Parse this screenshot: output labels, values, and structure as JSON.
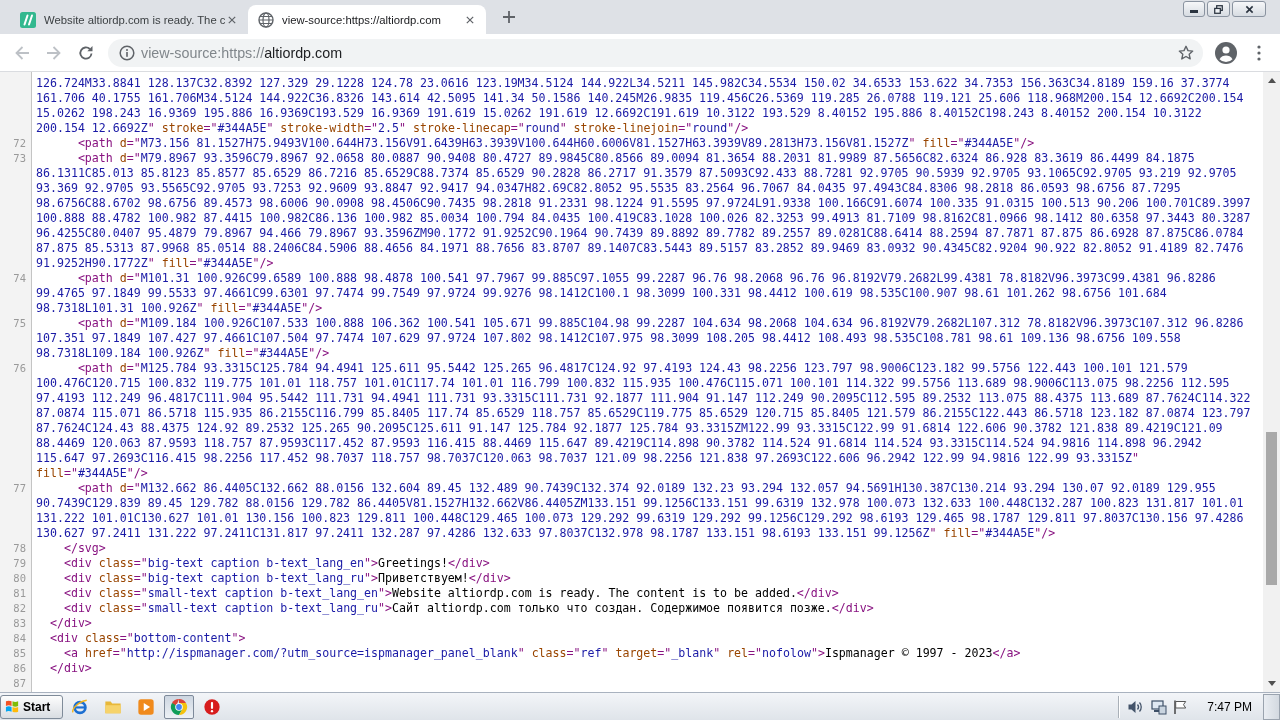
{
  "browser": {
    "tabs": [
      {
        "kind": "site",
        "title": "Website altiordp.com is ready. The c",
        "selected": false
      },
      {
        "kind": "source",
        "title": "view-source:https://altiordp.com",
        "selected": true
      }
    ],
    "nav": [
      {
        "kind": "back",
        "disabled": true
      },
      {
        "kind": "forward",
        "disabled": true
      },
      {
        "kind": "reload",
        "disabled": false
      }
    ],
    "address": {
      "scheme": "view-source:https://",
      "host": "altiordp.com"
    }
  },
  "source": {
    "lines": [
      {
        "parts": [
          {
            "tokens": [
              {
                "kind": "value",
                "text": "126.724M33.8841 128.137C32.8392 127.329 29.1228 124.78 23.0616 123.19M34.5124 144.922L34.5211 145.982C34.5534 150.02 34.6533 153.622 34.7353 156.363C34.8189 159.16 37.3774"
              }
            ]
          },
          {
            "tokens": [
              {
                "kind": "value",
                "text": "161.706 40.1755 161.706M34.5124 144.922C36.8326 143.614 42.5095 141.34 50.1586 140.245M26.9835 119.456C26.5369 119.285 26.0788 119.121 25.606 118.968M200.154 12.6692C200.154"
              }
            ]
          },
          {
            "tokens": [
              {
                "kind": "value",
                "text": "15.0262 198.243 16.9369 195.886 16.9369C193.529 16.9369 191.619 15.0262 191.619 12.6692C191.619 10.3122 193.529 8.40152 195.886 8.40152C198.243 8.40152 200.154 10.3122"
              }
            ]
          },
          {
            "tokens": [
              {
                "kind": "value",
                "text": "200.154 12.6692Z"
              },
              {
                "kind": "tag",
                "text": "\" "
              },
              {
                "kind": "attr",
                "text": "stroke"
              },
              {
                "kind": "tag",
                "text": "=\""
              },
              {
                "kind": "value",
                "text": "#344A5E"
              },
              {
                "kind": "tag",
                "text": "\" "
              },
              {
                "kind": "attr",
                "text": "stroke-width"
              },
              {
                "kind": "tag",
                "text": "=\""
              },
              {
                "kind": "value",
                "text": "2.5"
              },
              {
                "kind": "tag",
                "text": "\" "
              },
              {
                "kind": "attr",
                "text": "stroke-linecap"
              },
              {
                "kind": "tag",
                "text": "=\""
              },
              {
                "kind": "value",
                "text": "round"
              },
              {
                "kind": "tag",
                "text": "\" "
              },
              {
                "kind": "attr",
                "text": "stroke-linejoin"
              },
              {
                "kind": "tag",
                "text": "=\""
              },
              {
                "kind": "value",
                "text": "round"
              },
              {
                "kind": "tag",
                "text": "\"/>"
              }
            ]
          }
        ]
      },
      {
        "number": "72",
        "parts": [
          {
            "tokens": [
              {
                "kind": "tag",
                "text": "      <path "
              },
              {
                "kind": "attr",
                "text": "d"
              },
              {
                "kind": "tag",
                "text": "=\""
              },
              {
                "kind": "value",
                "text": "M73.156 81.1527H75.9493V100.644H73.156V91.6439H63.3939V100.644H60.6006V81.1527H63.3939V89.2813H73.156V81.1527Z"
              },
              {
                "kind": "tag",
                "text": "\" "
              },
              {
                "kind": "attr",
                "text": "fill"
              },
              {
                "kind": "tag",
                "text": "=\""
              },
              {
                "kind": "value",
                "text": "#344A5E"
              },
              {
                "kind": "tag",
                "text": "\"/>"
              }
            ]
          }
        ]
      },
      {
        "number": "73",
        "parts": [
          {
            "tokens": [
              {
                "kind": "tag",
                "text": "      <path "
              },
              {
                "kind": "attr",
                "text": "d"
              },
              {
                "kind": "tag",
                "text": "=\""
              },
              {
                "kind": "value",
                "text": "M79.8967 93.3596C79.8967 92.0658 80.0887 90.9408 80.4727 89.9845C80.8566 89.0094 81.3654 88.2031 81.9989 87.5656C82.6324 86.928 83.3619 86.4499 84.1875"
              }
            ]
          },
          {
            "tokens": [
              {
                "kind": "value",
                "text": "86.1311C85.013 85.8123 85.8577 85.6529 86.7216 85.6529C88.7374 85.6529 90.2828 86.2717 91.3579 87.5093C92.433 88.7281 92.9705 90.5939 92.9705 93.1065C92.9705 93.219 92.9705"
              }
            ]
          },
          {
            "tokens": [
              {
                "kind": "value",
                "text": "93.369 92.9705 93.5565C92.9705 93.7253 92.9609 93.8847 92.9417 94.0347H82.69C82.8052 95.5535 83.2564 96.7067 84.0435 97.4943C84.8306 98.2818 86.0593 98.6756 87.7295"
              }
            ]
          },
          {
            "tokens": [
              {
                "kind": "value",
                "text": "98.6756C88.6702 98.6756 89.4573 98.6006 90.0908 98.4506C90.7435 98.2818 91.2331 98.1224 91.5595 97.9724L91.9338 100.166C91.6074 100.335 91.0315 100.513 90.206 100.701C89.3997"
              }
            ]
          },
          {
            "tokens": [
              {
                "kind": "value",
                "text": "100.888 88.4782 100.982 87.4415 100.982C86.136 100.982 85.0034 100.794 84.0435 100.419C83.1028 100.026 82.3253 99.4913 81.7109 98.8162C81.0966 98.1412 80.6358 97.3443 80.3287"
              }
            ]
          },
          {
            "tokens": [
              {
                "kind": "value",
                "text": "96.4255C80.0407 95.4879 79.8967 94.466 79.8967 93.3596ZM90.1772 91.9252C90.1964 90.7439 89.8892 89.7782 89.2557 89.0281C88.6414 88.2594 87.7871 87.875 86.6928 87.875C86.0784"
              }
            ]
          },
          {
            "tokens": [
              {
                "kind": "value",
                "text": "87.875 85.5313 87.9968 85.0514 88.2406C84.5906 88.4656 84.1971 88.7656 83.8707 89.1407C83.5443 89.5157 83.2852 89.9469 83.0932 90.4345C82.9204 90.922 82.8052 91.4189 82.7476"
              }
            ]
          },
          {
            "tokens": [
              {
                "kind": "value",
                "text": "91.9252H90.1772Z"
              },
              {
                "kind": "tag",
                "text": "\" "
              },
              {
                "kind": "attr",
                "text": "fill"
              },
              {
                "kind": "tag",
                "text": "=\""
              },
              {
                "kind": "value",
                "text": "#344A5E"
              },
              {
                "kind": "tag",
                "text": "\"/>"
              }
            ]
          }
        ]
      },
      {
        "number": "74",
        "parts": [
          {
            "tokens": [
              {
                "kind": "tag",
                "text": "      <path "
              },
              {
                "kind": "attr",
                "text": "d"
              },
              {
                "kind": "tag",
                "text": "=\""
              },
              {
                "kind": "value",
                "text": "M101.31 100.926C99.6589 100.888 98.4878 100.541 97.7967 99.885C97.1055 99.2287 96.76 98.2068 96.76 96.8192V79.2682L99.4381 78.8182V96.3973C99.4381 96.8286"
              }
            ]
          },
          {
            "tokens": [
              {
                "kind": "value",
                "text": "99.4765 97.1849 99.5533 97.4661C99.6301 97.7474 99.7549 97.9724 99.9276 98.1412C100.1 98.3099 100.331 98.4412 100.619 98.535C100.907 98.61 101.262 98.6756 101.684"
              }
            ]
          },
          {
            "tokens": [
              {
                "kind": "value",
                "text": "98.7318L101.31 100.926Z"
              },
              {
                "kind": "tag",
                "text": "\" "
              },
              {
                "kind": "attr",
                "text": "fill"
              },
              {
                "kind": "tag",
                "text": "=\""
              },
              {
                "kind": "value",
                "text": "#344A5E"
              },
              {
                "kind": "tag",
                "text": "\"/>"
              }
            ]
          }
        ]
      },
      {
        "number": "75",
        "parts": [
          {
            "tokens": [
              {
                "kind": "tag",
                "text": "      <path "
              },
              {
                "kind": "attr",
                "text": "d"
              },
              {
                "kind": "tag",
                "text": "=\""
              },
              {
                "kind": "value",
                "text": "M109.184 100.926C107.533 100.888 106.362 100.541 105.671 99.885C104.98 99.2287 104.634 98.2068 104.634 96.8192V79.2682L107.312 78.8182V96.3973C107.312 96.8286"
              }
            ]
          },
          {
            "tokens": [
              {
                "kind": "value",
                "text": "107.351 97.1849 107.427 97.4661C107.504 97.7474 107.629 97.9724 107.802 98.1412C107.975 98.3099 108.205 98.4412 108.493 98.535C108.781 98.61 109.136 98.6756 109.558"
              }
            ]
          },
          {
            "tokens": [
              {
                "kind": "value",
                "text": "98.7318L109.184 100.926Z"
              },
              {
                "kind": "tag",
                "text": "\" "
              },
              {
                "kind": "attr",
                "text": "fill"
              },
              {
                "kind": "tag",
                "text": "=\""
              },
              {
                "kind": "value",
                "text": "#344A5E"
              },
              {
                "kind": "tag",
                "text": "\"/>"
              }
            ]
          }
        ]
      },
      {
        "number": "76",
        "parts": [
          {
            "tokens": [
              {
                "kind": "tag",
                "text": "      <path "
              },
              {
                "kind": "attr",
                "text": "d"
              },
              {
                "kind": "tag",
                "text": "=\""
              },
              {
                "kind": "value",
                "text": "M125.784 93.3315C125.784 94.4941 125.611 95.5442 125.265 96.4817C124.92 97.4193 124.43 98.2256 123.797 98.9006C123.182 99.5756 122.443 100.101 121.579"
              }
            ]
          },
          {
            "tokens": [
              {
                "kind": "value",
                "text": "100.476C120.715 100.832 119.775 101.01 118.757 101.01C117.74 101.01 116.799 100.832 115.935 100.476C115.071 100.101 114.322 99.5756 113.689 98.9006C113.075 98.2256 112.595"
              }
            ]
          },
          {
            "tokens": [
              {
                "kind": "value",
                "text": "97.4193 112.249 96.4817C111.904 95.5442 111.731 94.4941 111.731 93.3315C111.731 92.1877 111.904 91.147 112.249 90.2095C112.595 89.2532 113.075 88.4375 113.689 87.7624C114.322"
              }
            ]
          },
          {
            "tokens": [
              {
                "kind": "value",
                "text": "87.0874 115.071 86.5718 115.935 86.2155C116.799 85.8405 117.74 85.6529 118.757 85.6529C119.775 85.6529 120.715 85.8405 121.579 86.2155C122.443 86.5718 123.182 87.0874 123.797"
              }
            ]
          },
          {
            "tokens": [
              {
                "kind": "value",
                "text": "87.7624C124.43 88.4375 124.92 89.2532 125.265 90.2095C125.611 91.147 125.784 92.1877 125.784 93.3315ZM122.99 93.3315C122.99 91.6814 122.606 90.3782 121.838 89.4219C121.09"
              }
            ]
          },
          {
            "tokens": [
              {
                "kind": "value",
                "text": "88.4469 120.063 87.9593 118.757 87.9593C117.452 87.9593 116.415 88.4469 115.647 89.4219C114.898 90.3782 114.524 91.6814 114.524 93.3315C114.524 94.9816 114.898 96.2942"
              }
            ]
          },
          {
            "tokens": [
              {
                "kind": "value",
                "text": "115.647 97.2693C116.415 98.2256 117.452 98.7037 118.757 98.7037C120.063 98.7037 121.09 98.2256 121.838 97.2693C122.606 96.2942 122.99 94.9816 122.99 93.3315Z"
              },
              {
                "kind": "tag",
                "text": "\""
              }
            ]
          },
          {
            "tokens": [
              {
                "kind": "attr",
                "text": "fill"
              },
              {
                "kind": "tag",
                "text": "=\""
              },
              {
                "kind": "value",
                "text": "#344A5E"
              },
              {
                "kind": "tag",
                "text": "\"/>"
              }
            ]
          }
        ]
      },
      {
        "number": "77",
        "parts": [
          {
            "tokens": [
              {
                "kind": "tag",
                "text": "      <path "
              },
              {
                "kind": "attr",
                "text": "d"
              },
              {
                "kind": "tag",
                "text": "=\""
              },
              {
                "kind": "value",
                "text": "M132.662 86.4405C132.662 88.0156 132.604 89.45 132.489 90.7439C132.374 92.0189 132.23 93.294 132.057 94.5691H130.387C130.214 93.294 130.07 92.0189 129.955"
              }
            ]
          },
          {
            "tokens": [
              {
                "kind": "value",
                "text": "90.7439C129.839 89.45 129.782 88.0156 129.782 86.4405V81.1527H132.662V86.4405ZM133.151 99.1256C133.151 99.6319 132.978 100.073 132.633 100.448C132.287 100.823 131.817 101.01"
              }
            ]
          },
          {
            "tokens": [
              {
                "kind": "value",
                "text": "131.222 101.01C130.627 101.01 130.156 100.823 129.811 100.448C129.465 100.073 129.292 99.6319 129.292 99.1256C129.292 98.6193 129.465 98.1787 129.811 97.8037C130.156 97.4286"
              }
            ]
          },
          {
            "tokens": [
              {
                "kind": "value",
                "text": "130.627 97.2411 131.222 97.2411C131.817 97.2411 132.287 97.4286 132.633 97.8037C132.978 98.1787 133.151 98.6193 133.151 99.1256Z"
              },
              {
                "kind": "tag",
                "text": "\" "
              },
              {
                "kind": "attr",
                "text": "fill"
              },
              {
                "kind": "tag",
                "text": "=\""
              },
              {
                "kind": "value",
                "text": "#344A5E"
              },
              {
                "kind": "tag",
                "text": "\"/>"
              }
            ]
          }
        ]
      },
      {
        "number": "78",
        "parts": [
          {
            "tokens": [
              {
                "kind": "tag",
                "text": "    </svg>"
              }
            ]
          }
        ]
      },
      {
        "number": "79",
        "parts": [
          {
            "tokens": [
              {
                "kind": "tag",
                "text": "    <div "
              },
              {
                "kind": "attr",
                "text": "class"
              },
              {
                "kind": "tag",
                "text": "=\""
              },
              {
                "kind": "value",
                "text": "big-text caption b-text_lang_en"
              },
              {
                "kind": "tag",
                "text": "\">"
              },
              {
                "kind": "text",
                "text": "Greetings!"
              },
              {
                "kind": "tag",
                "text": "</div>"
              }
            ]
          }
        ]
      },
      {
        "number": "80",
        "parts": [
          {
            "tokens": [
              {
                "kind": "tag",
                "text": "    <div "
              },
              {
                "kind": "attr",
                "text": "class"
              },
              {
                "kind": "tag",
                "text": "=\""
              },
              {
                "kind": "value",
                "text": "big-text caption b-text_lang_ru"
              },
              {
                "kind": "tag",
                "text": "\">"
              },
              {
                "kind": "text",
                "text": "Приветствуем!"
              },
              {
                "kind": "tag",
                "text": "</div>"
              }
            ]
          }
        ]
      },
      {
        "number": "81",
        "parts": [
          {
            "tokens": [
              {
                "kind": "tag",
                "text": "    <div "
              },
              {
                "kind": "attr",
                "text": "class"
              },
              {
                "kind": "tag",
                "text": "=\""
              },
              {
                "kind": "value",
                "text": "small-text caption b-text_lang_en"
              },
              {
                "kind": "tag",
                "text": "\">"
              },
              {
                "kind": "text",
                "text": "Website altiordp.com is ready. The content is to be added."
              },
              {
                "kind": "tag",
                "text": "</div>"
              }
            ]
          }
        ]
      },
      {
        "number": "82",
        "parts": [
          {
            "tokens": [
              {
                "kind": "tag",
                "text": "    <div "
              },
              {
                "kind": "attr",
                "text": "class"
              },
              {
                "kind": "tag",
                "text": "=\""
              },
              {
                "kind": "value",
                "text": "small-text caption b-text_lang_ru"
              },
              {
                "kind": "tag",
                "text": "\">"
              },
              {
                "kind": "text",
                "text": "Сайт altiordp.com только что создан. Содержимое появится позже."
              },
              {
                "kind": "tag",
                "text": "</div>"
              }
            ]
          }
        ]
      },
      {
        "number": "83",
        "parts": [
          {
            "tokens": [
              {
                "kind": "tag",
                "text": "  </div>"
              }
            ]
          }
        ]
      },
      {
        "number": "84",
        "parts": [
          {
            "tokens": [
              {
                "kind": "tag",
                "text": "  <div "
              },
              {
                "kind": "attr",
                "text": "class"
              },
              {
                "kind": "tag",
                "text": "=\""
              },
              {
                "kind": "value",
                "text": "bottom-content"
              },
              {
                "kind": "tag",
                "text": "\">"
              }
            ]
          }
        ]
      },
      {
        "number": "85",
        "parts": [
          {
            "tokens": [
              {
                "kind": "tag",
                "text": "    <a "
              },
              {
                "kind": "attr",
                "text": "href"
              },
              {
                "kind": "tag",
                "text": "=\""
              },
              {
                "kind": "value",
                "text": "http://ispmanager.com/?utm_source=ispmanager_panel_blank"
              },
              {
                "kind": "tag",
                "text": "\" "
              },
              {
                "kind": "attr",
                "text": "class"
              },
              {
                "kind": "tag",
                "text": "=\""
              },
              {
                "kind": "value",
                "text": "ref"
              },
              {
                "kind": "tag",
                "text": "\" "
              },
              {
                "kind": "attr",
                "text": "target"
              },
              {
                "kind": "tag",
                "text": "=\""
              },
              {
                "kind": "value",
                "text": "_blank"
              },
              {
                "kind": "tag",
                "text": "\" "
              },
              {
                "kind": "attr",
                "text": "rel"
              },
              {
                "kind": "tag",
                "text": "=\""
              },
              {
                "kind": "value",
                "text": "nofolow"
              },
              {
                "kind": "tag",
                "text": "\">"
              },
              {
                "kind": "text",
                "text": "Ispmanager © 1997 - 2023"
              },
              {
                "kind": "tag",
                "text": "</a>"
              }
            ]
          }
        ]
      },
      {
        "number": "86",
        "parts": [
          {
            "tokens": [
              {
                "kind": "tag",
                "text": "  </div>"
              }
            ]
          }
        ]
      },
      {
        "number": "87"
      }
    ]
  },
  "taskbar": {
    "start": "Start",
    "apps": [
      {
        "kind": "web",
        "selected": false
      },
      {
        "kind": "folder",
        "selected": false
      },
      {
        "kind": "media",
        "selected": false
      },
      {
        "kind": "browser",
        "selected": true
      },
      {
        "kind": "alert",
        "selected": false
      }
    ],
    "clock": "7:47 PM"
  }
}
